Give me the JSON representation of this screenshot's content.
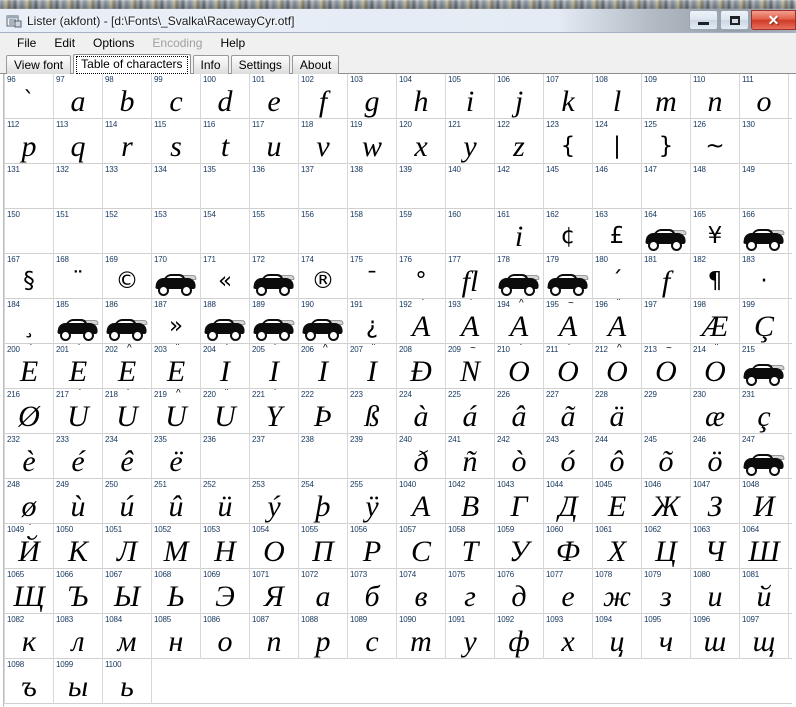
{
  "window": {
    "title": "Lister (akfont) - [d:\\Fonts\\_Svalka\\RacewayCyr.otf]",
    "icon": "document-viewer-icon",
    "minimize_label": "–",
    "maximize_label": "□",
    "close_label": "✕"
  },
  "menu": {
    "items": [
      {
        "label": "File",
        "disabled": false
      },
      {
        "label": "Edit",
        "disabled": false
      },
      {
        "label": "Options",
        "disabled": false
      },
      {
        "label": "Encoding",
        "disabled": true
      },
      {
        "label": "Help",
        "disabled": false
      }
    ]
  },
  "tabs": {
    "active_index": 1,
    "items": [
      {
        "label": "View font"
      },
      {
        "label": "Table of characters"
      },
      {
        "label": "Info"
      },
      {
        "label": "Settings"
      },
      {
        "label": "About"
      }
    ]
  },
  "char_table": {
    "columns": 16,
    "rows": [
      {
        "cells": [
          {
            "code": "96",
            "glyph": "`",
            "kind": "sym"
          },
          {
            "code": "97",
            "glyph": "a"
          },
          {
            "code": "98",
            "glyph": "b"
          },
          {
            "code": "99",
            "glyph": "c"
          },
          {
            "code": "100",
            "glyph": "d"
          },
          {
            "code": "101",
            "glyph": "e"
          },
          {
            "code": "102",
            "glyph": "f"
          },
          {
            "code": "103",
            "glyph": "g"
          },
          {
            "code": "104",
            "glyph": "h"
          },
          {
            "code": "105",
            "glyph": "i"
          },
          {
            "code": "106",
            "glyph": "j"
          },
          {
            "code": "107",
            "glyph": "k"
          },
          {
            "code": "108",
            "glyph": "l"
          },
          {
            "code": "109",
            "glyph": "m"
          },
          {
            "code": "110",
            "glyph": "n"
          },
          {
            "code": "111",
            "glyph": "o"
          }
        ]
      },
      {
        "cells": [
          {
            "code": "112",
            "glyph": "p"
          },
          {
            "code": "113",
            "glyph": "q"
          },
          {
            "code": "114",
            "glyph": "r"
          },
          {
            "code": "115",
            "glyph": "s"
          },
          {
            "code": "116",
            "glyph": "t"
          },
          {
            "code": "117",
            "glyph": "u"
          },
          {
            "code": "118",
            "glyph": "v"
          },
          {
            "code": "119",
            "glyph": "w"
          },
          {
            "code": "120",
            "glyph": "x"
          },
          {
            "code": "121",
            "glyph": "y"
          },
          {
            "code": "122",
            "glyph": "z"
          },
          {
            "code": "123",
            "glyph": "{",
            "kind": "sym"
          },
          {
            "code": "124",
            "glyph": "|",
            "kind": "sym"
          },
          {
            "code": "125",
            "glyph": "}",
            "kind": "sym"
          },
          {
            "code": "126",
            "glyph": "~",
            "kind": "sym"
          },
          {
            "code": "130",
            "glyph": ""
          }
        ]
      },
      {
        "cells": [
          {
            "code": "131",
            "glyph": ""
          },
          {
            "code": "132",
            "glyph": ""
          },
          {
            "code": "133",
            "glyph": ""
          },
          {
            "code": "134",
            "glyph": ""
          },
          {
            "code": "135",
            "glyph": ""
          },
          {
            "code": "136",
            "glyph": ""
          },
          {
            "code": "137",
            "glyph": ""
          },
          {
            "code": "138",
            "glyph": ""
          },
          {
            "code": "139",
            "glyph": ""
          },
          {
            "code": "140",
            "glyph": ""
          },
          {
            "code": "142",
            "glyph": ""
          },
          {
            "code": "145",
            "glyph": ""
          },
          {
            "code": "146",
            "glyph": ""
          },
          {
            "code": "147",
            "glyph": ""
          },
          {
            "code": "148",
            "glyph": ""
          },
          {
            "code": "149",
            "glyph": ""
          }
        ]
      },
      {
        "cells": [
          {
            "code": "150",
            "glyph": ""
          },
          {
            "code": "151",
            "glyph": ""
          },
          {
            "code": "152",
            "glyph": ""
          },
          {
            "code": "153",
            "glyph": ""
          },
          {
            "code": "154",
            "glyph": ""
          },
          {
            "code": "155",
            "glyph": ""
          },
          {
            "code": "156",
            "glyph": ""
          },
          {
            "code": "158",
            "glyph": ""
          },
          {
            "code": "159",
            "glyph": ""
          },
          {
            "code": "160",
            "glyph": ""
          },
          {
            "code": "161",
            "glyph": "i"
          },
          {
            "code": "162",
            "glyph": "¢",
            "kind": "sym"
          },
          {
            "code": "163",
            "glyph": "£",
            "kind": "sym"
          },
          {
            "code": "164",
            "glyph": "car",
            "kind": "car"
          },
          {
            "code": "165",
            "glyph": "¥",
            "kind": "sym"
          },
          {
            "code": "166",
            "glyph": "car",
            "kind": "car"
          }
        ]
      },
      {
        "cells": [
          {
            "code": "167",
            "glyph": "§",
            "kind": "sym"
          },
          {
            "code": "168",
            "glyph": "¨",
            "kind": "sym"
          },
          {
            "code": "169",
            "glyph": "©",
            "kind": "sym"
          },
          {
            "code": "170",
            "glyph": "car",
            "kind": "car"
          },
          {
            "code": "171",
            "glyph": "«",
            "kind": "sym"
          },
          {
            "code": "172",
            "glyph": "car",
            "kind": "car"
          },
          {
            "code": "174",
            "glyph": "®",
            "kind": "sym"
          },
          {
            "code": "175",
            "glyph": "¯",
            "kind": "sym"
          },
          {
            "code": "176",
            "glyph": "°",
            "kind": "sym"
          },
          {
            "code": "177",
            "glyph": "fl"
          },
          {
            "code": "178",
            "glyph": "car",
            "kind": "car"
          },
          {
            "code": "179",
            "glyph": "car",
            "kind": "car"
          },
          {
            "code": "180",
            "glyph": "´",
            "kind": "sym"
          },
          {
            "code": "181",
            "glyph": "f"
          },
          {
            "code": "182",
            "glyph": "¶",
            "kind": "sym"
          },
          {
            "code": "183",
            "glyph": "·",
            "kind": "sym"
          }
        ]
      },
      {
        "cells": [
          {
            "code": "184",
            "glyph": "¸",
            "kind": "sym"
          },
          {
            "code": "185",
            "glyph": "car",
            "kind": "car"
          },
          {
            "code": "186",
            "glyph": "car",
            "kind": "car"
          },
          {
            "code": "187",
            "glyph": "»",
            "kind": "sym"
          },
          {
            "code": "188",
            "glyph": "car",
            "kind": "car"
          },
          {
            "code": "189",
            "glyph": "car",
            "kind": "car"
          },
          {
            "code": "190",
            "glyph": "car",
            "kind": "car"
          },
          {
            "code": "191",
            "glyph": "¿",
            "kind": "sym"
          },
          {
            "code": "192",
            "glyph": "A",
            "accent": "`"
          },
          {
            "code": "193",
            "glyph": "A",
            "accent": "´"
          },
          {
            "code": "194",
            "glyph": "A",
            "accent": "^"
          },
          {
            "code": "195",
            "glyph": "A",
            "accent": "~"
          },
          {
            "code": "196",
            "glyph": "A",
            "accent": "¨"
          },
          {
            "code": "197",
            "glyph": ""
          },
          {
            "code": "198",
            "glyph": "Æ"
          },
          {
            "code": "199",
            "glyph": "Ç"
          }
        ]
      },
      {
        "cells": [
          {
            "code": "200",
            "glyph": "E",
            "accent": "`"
          },
          {
            "code": "201",
            "glyph": "E",
            "accent": "´"
          },
          {
            "code": "202",
            "glyph": "E",
            "accent": "^"
          },
          {
            "code": "203",
            "glyph": "E",
            "accent": "¨"
          },
          {
            "code": "204",
            "glyph": "I",
            "accent": "`"
          },
          {
            "code": "205",
            "glyph": "I",
            "accent": "´"
          },
          {
            "code": "206",
            "glyph": "I",
            "accent": "^"
          },
          {
            "code": "207",
            "glyph": "I",
            "accent": "¨"
          },
          {
            "code": "208",
            "glyph": "Ð"
          },
          {
            "code": "209",
            "glyph": "N",
            "accent": "~"
          },
          {
            "code": "210",
            "glyph": "O",
            "accent": "`"
          },
          {
            "code": "211",
            "glyph": "O",
            "accent": "´"
          },
          {
            "code": "212",
            "glyph": "O",
            "accent": "^"
          },
          {
            "code": "213",
            "glyph": "O",
            "accent": "~"
          },
          {
            "code": "214",
            "glyph": "O",
            "accent": "¨"
          },
          {
            "code": "215",
            "glyph": "car",
            "kind": "car"
          }
        ]
      },
      {
        "cells": [
          {
            "code": "216",
            "glyph": "Ø"
          },
          {
            "code": "217",
            "glyph": "U",
            "accent": "`"
          },
          {
            "code": "218",
            "glyph": "U",
            "accent": "´"
          },
          {
            "code": "219",
            "glyph": "U",
            "accent": "^"
          },
          {
            "code": "220",
            "glyph": "U",
            "accent": "¨"
          },
          {
            "code": "221",
            "glyph": "Y",
            "accent": "´"
          },
          {
            "code": "222",
            "glyph": "Þ"
          },
          {
            "code": "223",
            "glyph": "ß"
          },
          {
            "code": "224",
            "glyph": "à"
          },
          {
            "code": "225",
            "glyph": "á"
          },
          {
            "code": "226",
            "glyph": "â"
          },
          {
            "code": "227",
            "glyph": "ã"
          },
          {
            "code": "228",
            "glyph": "ä"
          },
          {
            "code": "229",
            "glyph": ""
          },
          {
            "code": "230",
            "glyph": "æ"
          },
          {
            "code": "231",
            "glyph": "ç"
          }
        ]
      },
      {
        "cells": [
          {
            "code": "232",
            "glyph": "è"
          },
          {
            "code": "233",
            "glyph": "é"
          },
          {
            "code": "234",
            "glyph": "ê"
          },
          {
            "code": "235",
            "glyph": "ë"
          },
          {
            "code": "236",
            "glyph": ""
          },
          {
            "code": "237",
            "glyph": ""
          },
          {
            "code": "238",
            "glyph": ""
          },
          {
            "code": "239",
            "glyph": ""
          },
          {
            "code": "240",
            "glyph": "ð"
          },
          {
            "code": "241",
            "glyph": "ñ"
          },
          {
            "code": "242",
            "glyph": "ò"
          },
          {
            "code": "243",
            "glyph": "ó"
          },
          {
            "code": "244",
            "glyph": "ô"
          },
          {
            "code": "245",
            "glyph": "õ"
          },
          {
            "code": "246",
            "glyph": "ö"
          },
          {
            "code": "247",
            "glyph": "car",
            "kind": "car"
          }
        ]
      },
      {
        "cells": [
          {
            "code": "248",
            "glyph": "ø"
          },
          {
            "code": "249",
            "glyph": "ù"
          },
          {
            "code": "250",
            "glyph": "ú"
          },
          {
            "code": "251",
            "glyph": "û"
          },
          {
            "code": "252",
            "glyph": "ü"
          },
          {
            "code": "253",
            "glyph": "ý"
          },
          {
            "code": "254",
            "glyph": "þ"
          },
          {
            "code": "255",
            "glyph": "ÿ"
          },
          {
            "code": "1040",
            "glyph": "А"
          },
          {
            "code": "1042",
            "glyph": "В"
          },
          {
            "code": "1043",
            "glyph": "Г"
          },
          {
            "code": "1044",
            "glyph": "Д"
          },
          {
            "code": "1045",
            "glyph": "Е"
          },
          {
            "code": "1046",
            "glyph": "Ж"
          },
          {
            "code": "1047",
            "glyph": "З"
          },
          {
            "code": "1048",
            "glyph": "И"
          }
        ]
      },
      {
        "cells": [
          {
            "code": "1049",
            "glyph": "Й",
            "accent": "´"
          },
          {
            "code": "1050",
            "glyph": "К"
          },
          {
            "code": "1051",
            "glyph": "Л"
          },
          {
            "code": "1052",
            "glyph": "М"
          },
          {
            "code": "1053",
            "glyph": "Н"
          },
          {
            "code": "1054",
            "glyph": "О"
          },
          {
            "code": "1055",
            "glyph": "П"
          },
          {
            "code": "1056",
            "glyph": "Р"
          },
          {
            "code": "1057",
            "glyph": "С"
          },
          {
            "code": "1058",
            "glyph": "Т"
          },
          {
            "code": "1059",
            "glyph": "У"
          },
          {
            "code": "1060",
            "glyph": "Ф"
          },
          {
            "code": "1061",
            "glyph": "Х"
          },
          {
            "code": "1062",
            "glyph": "Ц"
          },
          {
            "code": "1063",
            "glyph": "Ч"
          },
          {
            "code": "1064",
            "glyph": "Ш"
          }
        ]
      },
      {
        "cells": [
          {
            "code": "1065",
            "glyph": "Щ"
          },
          {
            "code": "1066",
            "glyph": "Ъ"
          },
          {
            "code": "1067",
            "glyph": "Ы"
          },
          {
            "code": "1068",
            "glyph": "Ь"
          },
          {
            "code": "1069",
            "glyph": "Э"
          },
          {
            "code": "1071",
            "glyph": "Я"
          },
          {
            "code": "1072",
            "glyph": "а"
          },
          {
            "code": "1073",
            "glyph": "б"
          },
          {
            "code": "1074",
            "glyph": "в"
          },
          {
            "code": "1075",
            "glyph": "г"
          },
          {
            "code": "1076",
            "glyph": "д"
          },
          {
            "code": "1077",
            "glyph": "е"
          },
          {
            "code": "1078",
            "glyph": "ж"
          },
          {
            "code": "1079",
            "glyph": "з"
          },
          {
            "code": "1080",
            "glyph": "и"
          },
          {
            "code": "1081",
            "glyph": "й"
          }
        ]
      },
      {
        "cells": [
          {
            "code": "1082",
            "glyph": "к"
          },
          {
            "code": "1083",
            "glyph": "л"
          },
          {
            "code": "1084",
            "glyph": "м"
          },
          {
            "code": "1085",
            "glyph": "н"
          },
          {
            "code": "1086",
            "glyph": "о"
          },
          {
            "code": "1087",
            "glyph": "п"
          },
          {
            "code": "1088",
            "glyph": "р"
          },
          {
            "code": "1089",
            "glyph": "с"
          },
          {
            "code": "1090",
            "glyph": "т"
          },
          {
            "code": "1091",
            "glyph": "у"
          },
          {
            "code": "1092",
            "glyph": "ф"
          },
          {
            "code": "1093",
            "glyph": "х"
          },
          {
            "code": "1094",
            "glyph": "ц"
          },
          {
            "code": "1095",
            "glyph": "ч"
          },
          {
            "code": "1096",
            "glyph": "ш"
          },
          {
            "code": "1097",
            "glyph": "щ"
          }
        ]
      },
      {
        "cells": [
          {
            "code": "1098",
            "glyph": "ъ"
          },
          {
            "code": "1099",
            "glyph": "ы"
          },
          {
            "code": "1100",
            "glyph": "ь"
          }
        ]
      }
    ]
  }
}
